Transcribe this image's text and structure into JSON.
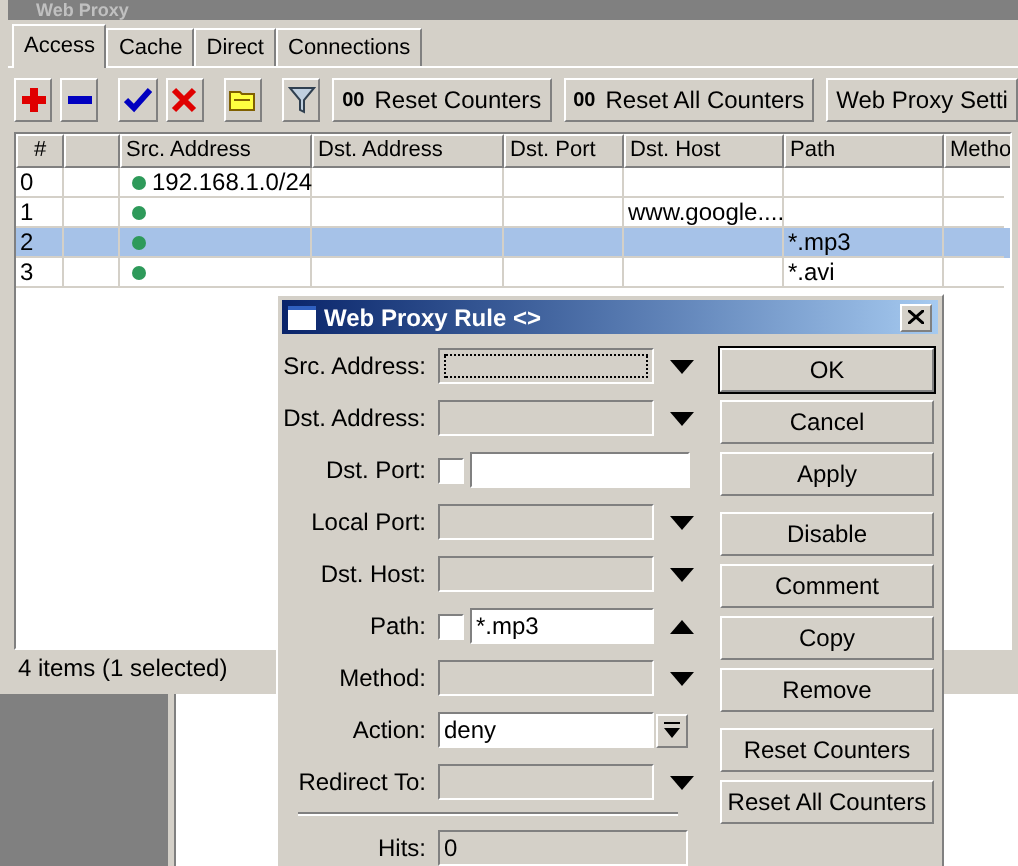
{
  "window": {
    "title": "Web Proxy"
  },
  "tabs": [
    {
      "label": "Access",
      "selected": true
    },
    {
      "label": "Cache",
      "selected": false
    },
    {
      "label": "Direct",
      "selected": false
    },
    {
      "label": "Connections",
      "selected": false
    }
  ],
  "toolbar": {
    "icon_buttons": [
      {
        "kind": "add"
      },
      {
        "kind": "remove"
      },
      {
        "kind": "enable"
      },
      {
        "kind": "disable"
      },
      {
        "kind": "comment"
      },
      {
        "kind": "filter"
      }
    ],
    "text_buttons": [
      {
        "icon_text": "00",
        "label": "Reset Counters"
      },
      {
        "icon_text": "00",
        "label": "Reset All Counters"
      },
      {
        "label": "Web Proxy Setti"
      }
    ]
  },
  "table": {
    "columns": [
      "#",
      "Src. Address",
      "Dst. Address",
      "Dst. Port",
      "Dst. Host",
      "Path",
      "Metho"
    ],
    "rows": [
      {
        "number": "0",
        "enabled": true,
        "selected": false,
        "src_address": "192.168.1.0/24",
        "dst_address": "",
        "dst_port": "",
        "dst_host": "",
        "path": ""
      },
      {
        "number": "1",
        "enabled": true,
        "selected": false,
        "src_address": "",
        "dst_address": "",
        "dst_port": "",
        "dst_host": "www.google....",
        "path": ""
      },
      {
        "number": "2",
        "enabled": true,
        "selected": true,
        "src_address": "",
        "dst_address": "",
        "dst_port": "",
        "dst_host": "",
        "path": "*.mp3"
      },
      {
        "number": "3",
        "enabled": true,
        "selected": false,
        "src_address": "",
        "dst_address": "",
        "dst_port": "",
        "dst_host": "",
        "path": "*.avi"
      }
    ]
  },
  "status_bar": "4 items (1 selected)",
  "dialog": {
    "title": "Web Proxy Rule <>",
    "fields": [
      {
        "label": "Src. Address:",
        "kind": "combo",
        "expanded": false,
        "focused": true
      },
      {
        "label": "Dst. Address:",
        "kind": "combo",
        "expanded": false,
        "focused": false
      },
      {
        "label": "Dst. Port:",
        "kind": "check-input",
        "checked": false
      },
      {
        "label": "Local Port:",
        "kind": "combo",
        "expanded": false,
        "focused": false
      },
      {
        "label": "Dst. Host:",
        "kind": "combo",
        "expanded": false,
        "focused": false
      },
      {
        "label": "Path:",
        "kind": "check-input",
        "checked": false,
        "value": "*.mp3",
        "expanded": true
      },
      {
        "label": "Method:",
        "kind": "combo",
        "expanded": false,
        "focused": false
      },
      {
        "label": "Action:",
        "kind": "select",
        "value": "deny"
      },
      {
        "label": "Redirect To:",
        "kind": "combo",
        "expanded": false,
        "focused": false
      },
      {
        "label": "Hits:",
        "kind": "readonly",
        "value": "0"
      }
    ],
    "button_groups": [
      [
        {
          "label": "OK",
          "default": true
        },
        {
          "label": "Cancel",
          "default": false
        },
        {
          "label": "Apply",
          "default": false
        }
      ],
      [
        {
          "label": "Disable",
          "default": false
        },
        {
          "label": "Comment",
          "default": false
        },
        {
          "label": "Copy",
          "default": false
        },
        {
          "label": "Remove",
          "default": false
        }
      ],
      [
        {
          "label": "Reset Counters",
          "default": false
        },
        {
          "label": "Reset All Counters",
          "default": false
        }
      ]
    ]
  }
}
